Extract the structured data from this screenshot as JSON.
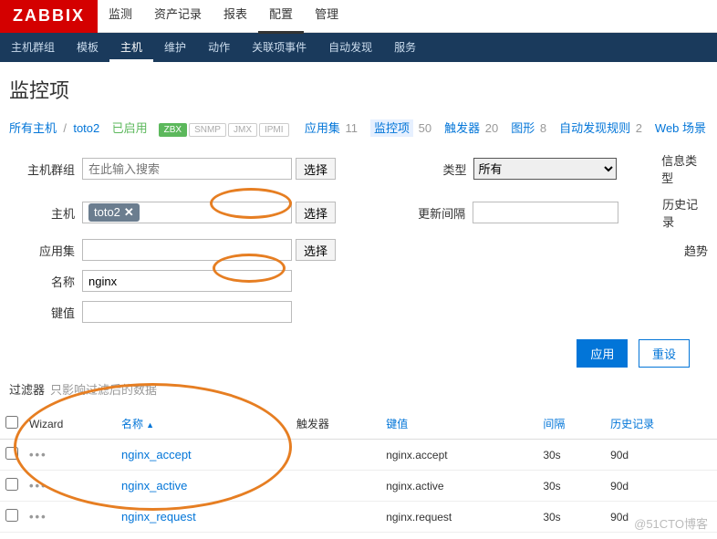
{
  "brand": "ZABBIX",
  "topnav": [
    "监测",
    "资产记录",
    "报表",
    "配置",
    "管理"
  ],
  "topnav_active": 3,
  "subnav": [
    "主机群组",
    "模板",
    "主机",
    "维护",
    "动作",
    "关联项事件",
    "自动发现",
    "服务"
  ],
  "subnav_active": 2,
  "page_title": "监控项",
  "crumb": {
    "all_hosts": "所有主机",
    "host": "toto2",
    "enabled": "已启用"
  },
  "host_tags": [
    "ZBX",
    "SNMP",
    "JMX",
    "IPMI"
  ],
  "host_stats": [
    {
      "label": "应用集",
      "count": 11
    },
    {
      "label": "监控项",
      "count": 50,
      "current": true
    },
    {
      "label": "触发器",
      "count": 20
    },
    {
      "label": "图形",
      "count": 8
    },
    {
      "label": "自动发现规则",
      "count": 2
    },
    {
      "label": "Web 场景",
      "count": ""
    }
  ],
  "filter": {
    "labels": {
      "group": "主机群组",
      "host": "主机",
      "app": "应用集",
      "name": "名称",
      "key": "键值",
      "type": "类型",
      "interval": "更新间隔",
      "info": "信息类型",
      "history": "历史记录",
      "trend": "趋势"
    },
    "group_placeholder": "在此输入搜索",
    "host_token": "toto2",
    "name_value": "nginx",
    "select_btn": "选择",
    "type_value": "所有"
  },
  "buttons": {
    "apply": "应用",
    "reset": "重设"
  },
  "filter_header": {
    "title": "过滤器",
    "sub": "只影响过滤后的数据"
  },
  "columns": {
    "wizard": "Wizard",
    "name": "名称",
    "triggers": "触发器",
    "key": "键值",
    "interval": "间隔",
    "history": "历史记录"
  },
  "rows": [
    {
      "name": "nginx_accept",
      "key": "nginx.accept",
      "interval": "30s",
      "history": "90d"
    },
    {
      "name": "nginx_active",
      "key": "nginx.active",
      "interval": "30s",
      "history": "90d"
    },
    {
      "name": "nginx_request",
      "key": "nginx.request",
      "interval": "30s",
      "history": "90d"
    }
  ],
  "watermark": "@51CTO博客"
}
